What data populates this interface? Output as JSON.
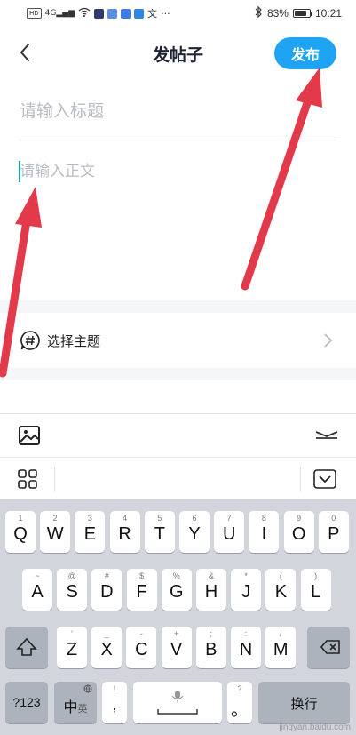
{
  "status_bar": {
    "hd_label": "HD",
    "signal_label": "4G",
    "ime_char": "文",
    "more": "···",
    "battery_percent": "83%",
    "battery_level": 0.83,
    "time": "10:21"
  },
  "header": {
    "title": "发帖子",
    "publish_label": "发布"
  },
  "form": {
    "title_placeholder": "请输入标题",
    "body_placeholder": "请输入正文"
  },
  "theme": {
    "label": "选择主题"
  },
  "colors": {
    "accent": "#1ea4f3",
    "annotation_arrow": "#e23a4b",
    "caret": "#1aa39b"
  },
  "keyboard": {
    "row1": [
      {
        "main": "Q",
        "sub": "1"
      },
      {
        "main": "W",
        "sub": "2"
      },
      {
        "main": "E",
        "sub": "3"
      },
      {
        "main": "R",
        "sub": "4"
      },
      {
        "main": "T",
        "sub": "5"
      },
      {
        "main": "Y",
        "sub": "6"
      },
      {
        "main": "U",
        "sub": "7"
      },
      {
        "main": "I",
        "sub": "8"
      },
      {
        "main": "O",
        "sub": "9"
      },
      {
        "main": "P",
        "sub": "0"
      }
    ],
    "row2": [
      {
        "main": "A",
        "sub": "~"
      },
      {
        "main": "S",
        "sub": "@"
      },
      {
        "main": "D",
        "sub": "#"
      },
      {
        "main": "F",
        "sub": "$"
      },
      {
        "main": "G",
        "sub": "%"
      },
      {
        "main": "H",
        "sub": "&"
      },
      {
        "main": "J",
        "sub": "*"
      },
      {
        "main": "K",
        "sub": "("
      },
      {
        "main": "L",
        "sub": ")"
      }
    ],
    "row3": [
      {
        "main": "Z",
        "sub": "'"
      },
      {
        "main": "X",
        "sub": "_"
      },
      {
        "main": "C",
        "sub": "-"
      },
      {
        "main": "V",
        "sub": "+"
      },
      {
        "main": "B",
        "sub": ";"
      },
      {
        "main": "N",
        "sub": ":"
      },
      {
        "main": "M",
        "sub": "/"
      }
    ],
    "sym_label": "?123",
    "lang_label": "中",
    "lang_sub": "英",
    "comma_label": ",",
    "comma_sub": "!",
    "period_label": "。",
    "period_sub": "?",
    "enter_label": "换行"
  },
  "watermark": "jingyan.baidu.com",
  "icons": [
    "back-icon",
    "hashtag-bubble-icon",
    "chevron-right-icon",
    "image-icon",
    "fold-icon",
    "grid-icon",
    "keyboard-hide-icon",
    "shift-icon",
    "backspace-icon",
    "microphone-icon",
    "globe-icon"
  ]
}
